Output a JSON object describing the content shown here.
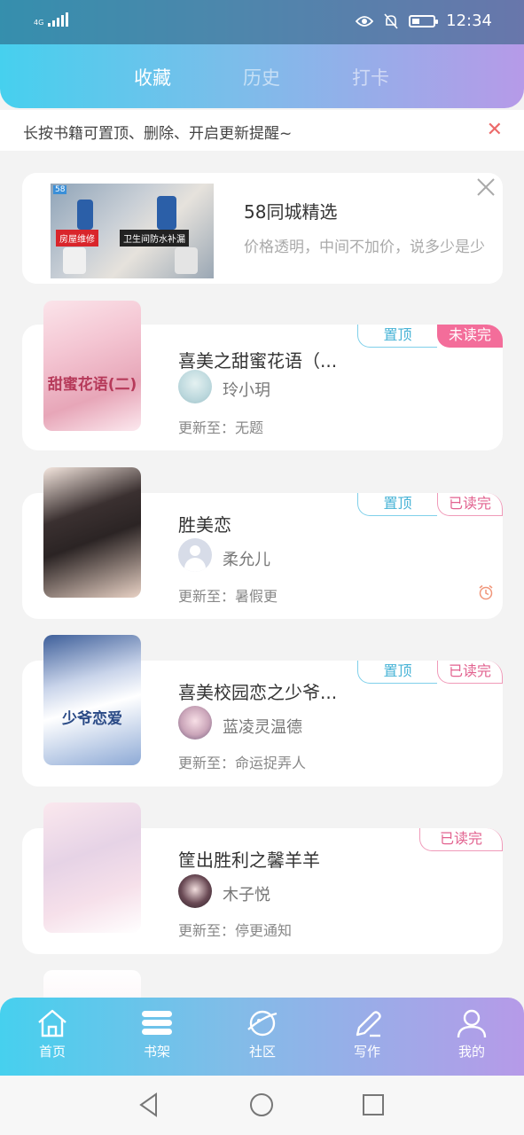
{
  "status_bar": {
    "network": "4G",
    "time": "12:34",
    "battery_level": 0.35
  },
  "tabs": [
    {
      "label": "收藏",
      "active": true
    },
    {
      "label": "历史",
      "active": false
    },
    {
      "label": "打卡",
      "active": false
    }
  ],
  "tip": {
    "text": "长按书籍可置顶、删除、开启更新提醒~",
    "close_icon": "close-x-icon"
  },
  "ad": {
    "title": "58同城精选",
    "description": "价格透明，中间不加价，说多少是少",
    "image_logo": "58",
    "image_tag_red": "房屋维修",
    "image_tag_black": "卫生间防水补漏"
  },
  "books": [
    {
      "title": "喜美之甜蜜花语（...",
      "author": "玲小玥",
      "update": "更新至：无题",
      "cover_title": "甜蜜花语(二)",
      "pinned": true,
      "pinned_label": "置顶",
      "read_status": "未读完",
      "unread": true,
      "alarm": false
    },
    {
      "title": "胜美恋",
      "author": "柔允儿",
      "update": "更新至：暑假更",
      "cover_title": "",
      "pinned": true,
      "pinned_label": "置顶",
      "read_status": "已读完",
      "unread": false,
      "alarm": true
    },
    {
      "title": "喜美校园恋之少爷...",
      "author": "蓝凌灵温德",
      "update": "更新至：命运捉弄人",
      "cover_title": "少爷恋爱",
      "pinned": true,
      "pinned_label": "置顶",
      "read_status": "已读完",
      "unread": false,
      "alarm": false
    },
    {
      "title": "筐出胜利之馨羊羊",
      "author": "木子悦",
      "update": "更新至：停更通知",
      "cover_title": "",
      "pinned": false,
      "pinned_label": "",
      "read_status": "已读完",
      "unread": false,
      "alarm": false
    }
  ],
  "bottom_nav": [
    {
      "label": "首页",
      "icon": "home-icon"
    },
    {
      "label": "书架",
      "icon": "bookshelf-icon"
    },
    {
      "label": "社区",
      "icon": "planet-icon"
    },
    {
      "label": "写作",
      "icon": "pen-icon"
    },
    {
      "label": "我的",
      "icon": "user-icon"
    }
  ],
  "colors": {
    "gradient_start": "#46d0ee",
    "gradient_end": "#b69ae8",
    "pinned_tag": "#47b3d6",
    "unread_tag": "#f36d9a",
    "read_tag": "#e2628f",
    "close_red": "#ec6a6a"
  }
}
